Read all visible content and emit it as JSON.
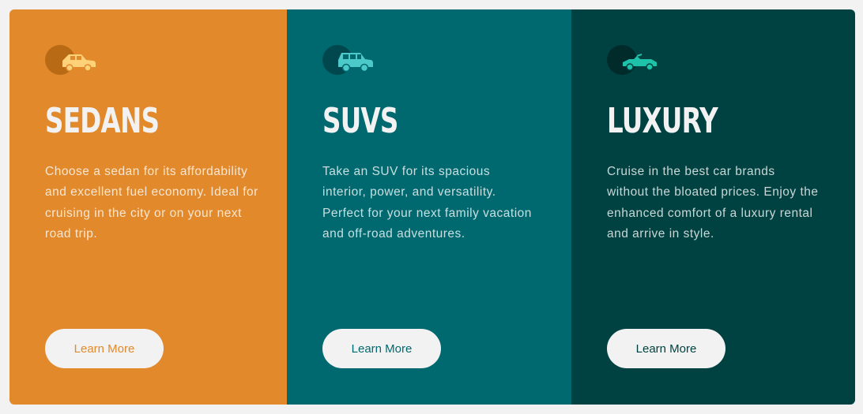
{
  "colors": {
    "page_background": "#f2f2f2",
    "sedans": "#e28a2b",
    "suvs": "#006970",
    "luxury": "#004241",
    "button_background": "#f2f2f2",
    "heading_text": "#f2f2f2"
  },
  "cards": [
    {
      "icon": "sedan-car-icon",
      "title": "SEDANS",
      "text": "Choose a sedan for its affordability and excellent fuel economy. Ideal for cruising in the city or on your next road trip.",
      "button_label": "Learn More"
    },
    {
      "icon": "suv-car-icon",
      "title": "SUVS",
      "text": "Take an SUV for its spacious interior, power, and versatility. Perfect for your next family vacation and off-road adventures.",
      "button_label": "Learn More"
    },
    {
      "icon": "luxury-car-icon",
      "title": "LUXURY",
      "text": "Cruise in the best car brands without the bloated prices. Enjoy the enhanced comfort of a luxury rental and arrive in style.",
      "button_label": "Learn More"
    }
  ]
}
